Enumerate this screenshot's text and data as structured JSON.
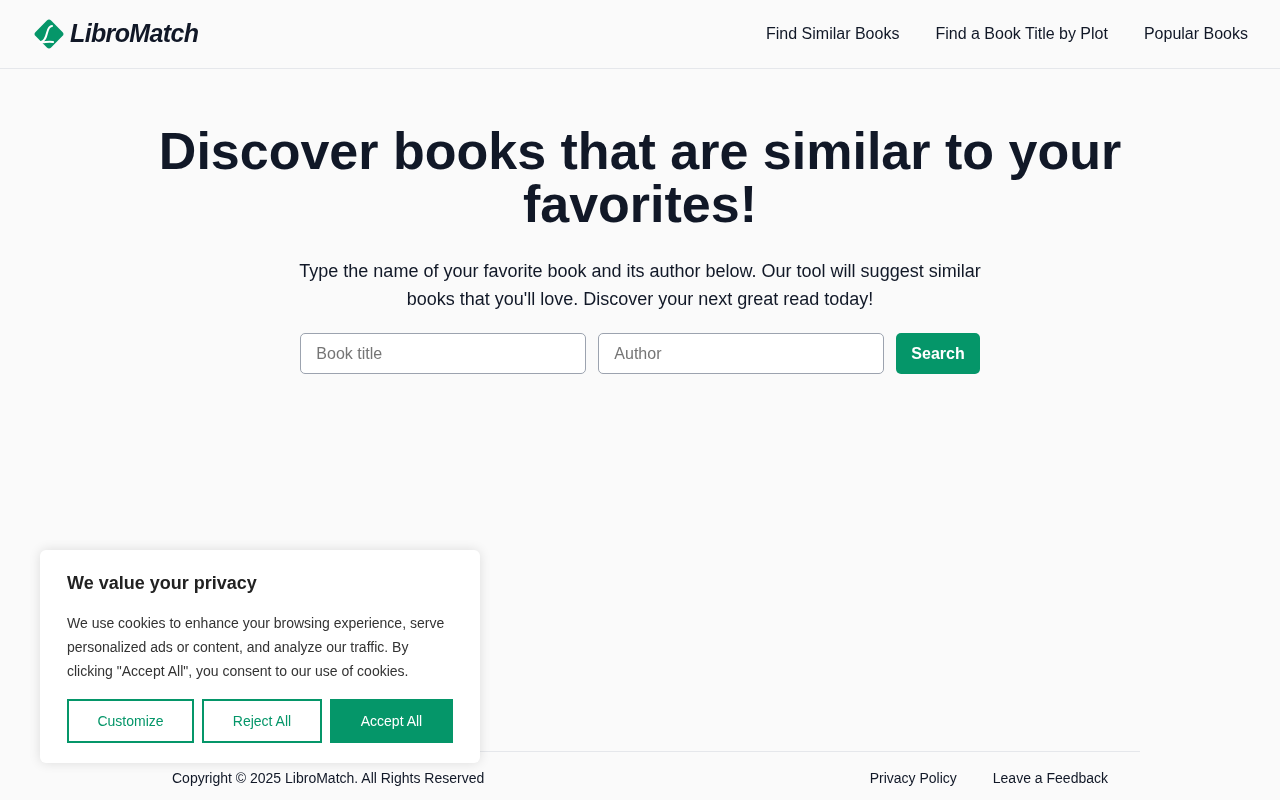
{
  "header": {
    "brand": "LibroMatch",
    "nav": [
      "Find Similar Books",
      "Find a Book Title by Plot",
      "Popular Books"
    ]
  },
  "hero": {
    "title": "Discover books that are similar to your favorites!",
    "subtitle": "Type the name of your favorite book and its author below. Our tool will suggest similar books that you'll love. Discover your next great read today!"
  },
  "search": {
    "fields": [
      {
        "placeholder": "Book title"
      },
      {
        "placeholder": "Author"
      }
    ],
    "button": "Search"
  },
  "cookie_banner": {
    "title": "We value your privacy",
    "text": "We use cookies to enhance your browsing experience, serve personalized ads or content, and analyze our traffic. By clicking \"Accept All\", you consent to our use of cookies.",
    "buttons": [
      {
        "label": "Customize",
        "kind": "outline"
      },
      {
        "label": "Reject All",
        "kind": "outline"
      },
      {
        "label": "Accept All",
        "kind": "filled"
      }
    ]
  },
  "footer": {
    "copyright": "Copyright © 2025 LibroMatch. All Rights Reserved",
    "links": [
      "Privacy Policy",
      "Leave a Feedback"
    ]
  }
}
